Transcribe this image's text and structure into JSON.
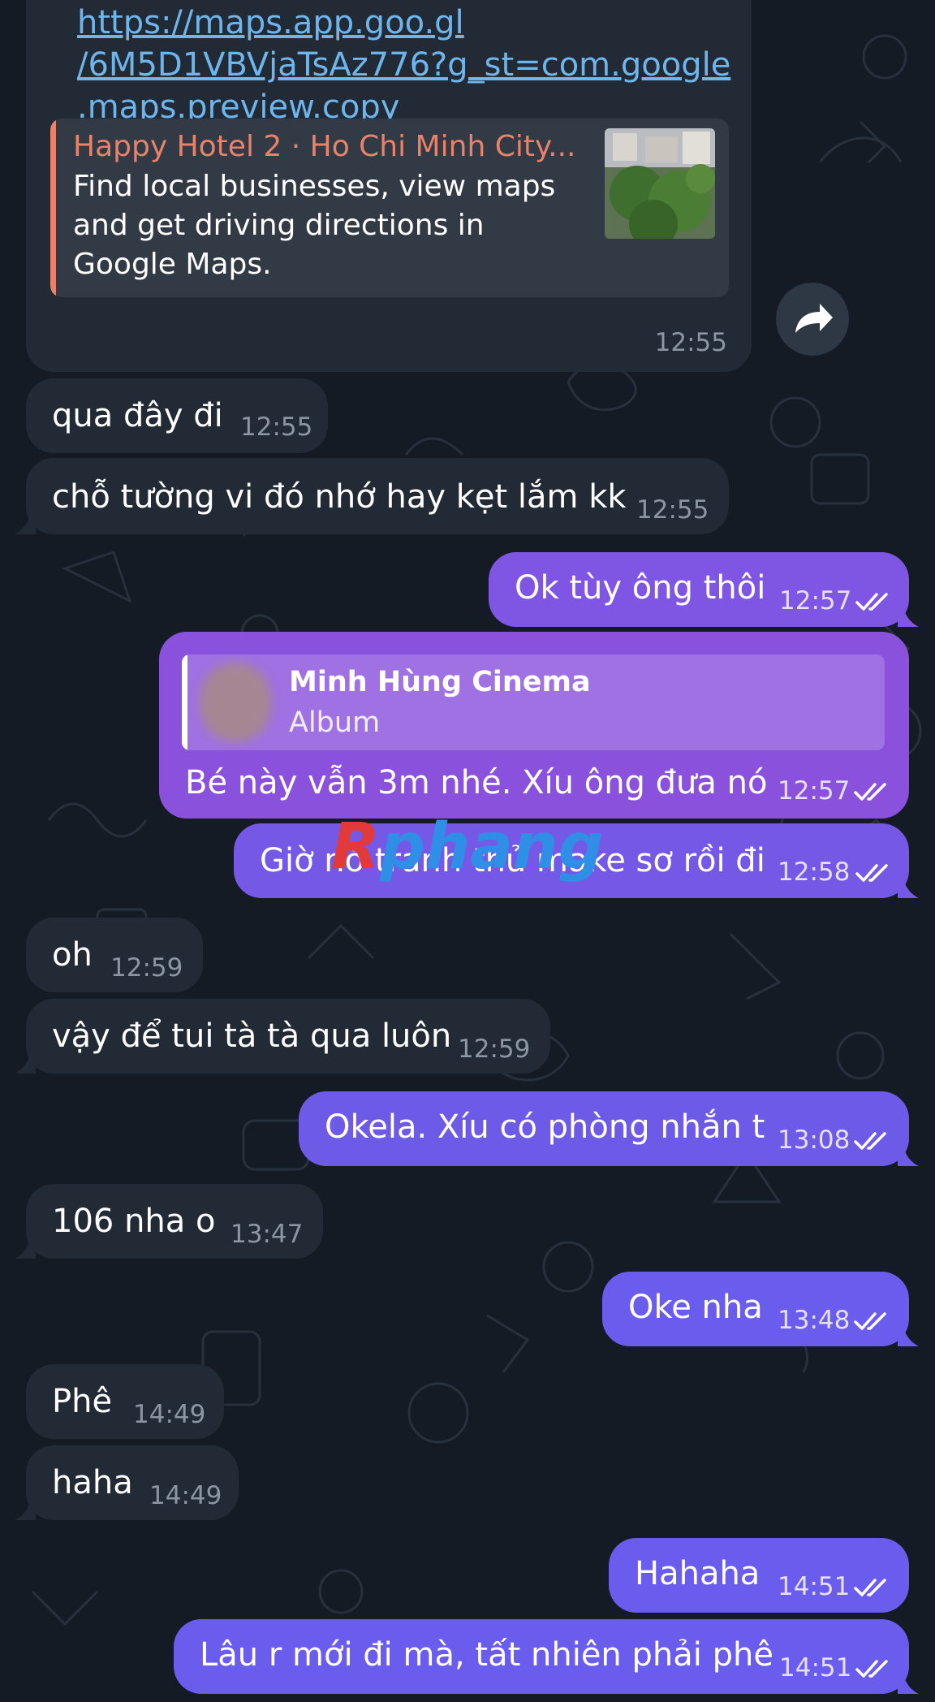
{
  "colors": {
    "background": "#151b24",
    "incoming_bubble": "#212a35",
    "outgoing_gradient": [
      "#9a4fd6",
      "#5a5ef0"
    ],
    "link": "#6eb5ec",
    "preview_title": "#e8826a"
  },
  "icons": {
    "share": "share-arrow-icon",
    "read": "double-check-icon"
  },
  "watermark": {
    "part1": "R",
    "part2": "phang"
  },
  "messages": [
    {
      "side": "in",
      "link": [
        "https://maps.app.goo.gl",
        "/6M5D1VBVjaTsAz776?g_st=com.google",
        ".maps.preview.copy"
      ],
      "preview": {
        "title": "Happy Hotel 2 · Ho Chi Minh City...",
        "description": "Find local businesses, view maps and get driving directions in Google Maps."
      },
      "time": "12:55"
    },
    {
      "side": "in",
      "text": "qua đây đi",
      "time": "12:55"
    },
    {
      "side": "in",
      "text": "chỗ tường vi đó nhớ hay kẹt lắm kk",
      "time": "12:55"
    },
    {
      "side": "out",
      "text": "Ok tùy ông thôi",
      "time": "12:57"
    },
    {
      "side": "out",
      "reply": {
        "name": "Minh Hùng Cinema",
        "subtitle": "Album"
      },
      "text": "Bé này vẫn 3m nhé. Xíu ông đưa nó",
      "time": "12:57"
    },
    {
      "side": "out",
      "text": "Giờ nó tranh thủ make sơ rồi đi",
      "time": "12:58"
    },
    {
      "side": "in",
      "text": "oh",
      "time": "12:59"
    },
    {
      "side": "in",
      "text": "vậy để tui tà tà qua luôn",
      "time": "12:59"
    },
    {
      "side": "out",
      "text": "Okela. Xíu có phòng nhắn t",
      "time": "13:08"
    },
    {
      "side": "in",
      "text": "106 nha o",
      "time": "13:47"
    },
    {
      "side": "out",
      "text": "Oke nha",
      "time": "13:48"
    },
    {
      "side": "in",
      "text": "Phê",
      "time": "14:49"
    },
    {
      "side": "in",
      "text": "haha",
      "time": "14:49"
    },
    {
      "side": "out",
      "text": "Hahaha",
      "time": "14:51"
    },
    {
      "side": "out",
      "text": "Lâu r mới đi mà, tất nhiên phải phê",
      "time": "14:51"
    }
  ]
}
